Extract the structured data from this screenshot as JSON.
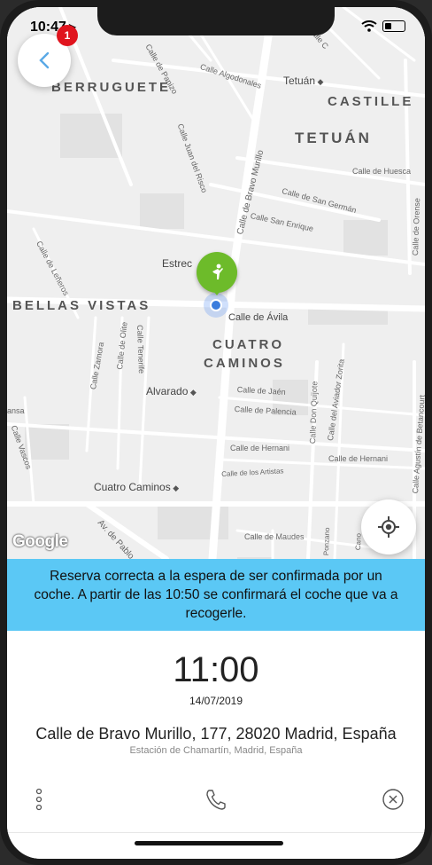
{
  "status_bar": {
    "time": "10:47",
    "notification_count": "1"
  },
  "map": {
    "districts": [
      "BERRUGUETE",
      "CASTILLE",
      "TETUÁN",
      "BELLAS VISTAS",
      "CUATRO",
      "CAMINOS"
    ],
    "metro_stations": [
      "Tetuán",
      "Estrec",
      "Alvarado",
      "Cuatro Caminos"
    ],
    "streets": {
      "paniza": "Calle de Panizo",
      "algodonales": "Calle Algodonales",
      "juan_risco": "Calle Juan del Risco",
      "bravo_murillo": "Calle de Bravo Murillo",
      "huesca": "Calle de Huesca",
      "san_german": "Calle de San Germán",
      "san_enrique": "Calle San Enrique",
      "orense": "Calle de Orense",
      "lefieros": "Calle de Leñeros",
      "avila": "Calle de Ávila",
      "zamora": "Calle Zamora",
      "olite": "Calle de Olite",
      "tenerife": "Calle Tenerife",
      "jaen": "Calle de Jaén",
      "palencia": "Calle de Palencia",
      "don_quijote": "Calle Don Quijote",
      "aviador_zorita": "Calle del Aviador Zorita",
      "betancourt": "Calle Agustín de Betancourt",
      "vascos": "Calle Vascos",
      "hernani_1": "Calle de Hernani",
      "hernani_2": "Calle de Hernani",
      "artistas": "Calle de los Artistas",
      "pablo": "Av. de Pablo",
      "maudes": "Calle de Maudes",
      "ponzano": "Ponzano",
      "cano": "Cano",
      "ansa": "ansa",
      "calle_c": "Calle C"
    },
    "attribution": "Google"
  },
  "banner": {
    "message": "Reserva correcta a la espera de ser confirmada por un coche. A partir de las 10:50 se confirmará el coche que va a recogerle."
  },
  "booking": {
    "time": "11:00",
    "date": "14/07/2019",
    "address": "Calle de Bravo Murillo, 177, 28020 Madrid, España",
    "sub_address": "Estación de Chamartín, Madrid, España"
  },
  "colors": {
    "banner_bg": "#5bc8f5",
    "pin_green": "#6dbb2a",
    "badge_red": "#e0141e",
    "back_blue": "#5aa9e6"
  },
  "icons": {
    "back": "chevron-left-icon",
    "locate": "crosshair-icon",
    "more": "more-vertical-icon",
    "phone": "phone-icon",
    "cancel": "circle-x-icon"
  }
}
